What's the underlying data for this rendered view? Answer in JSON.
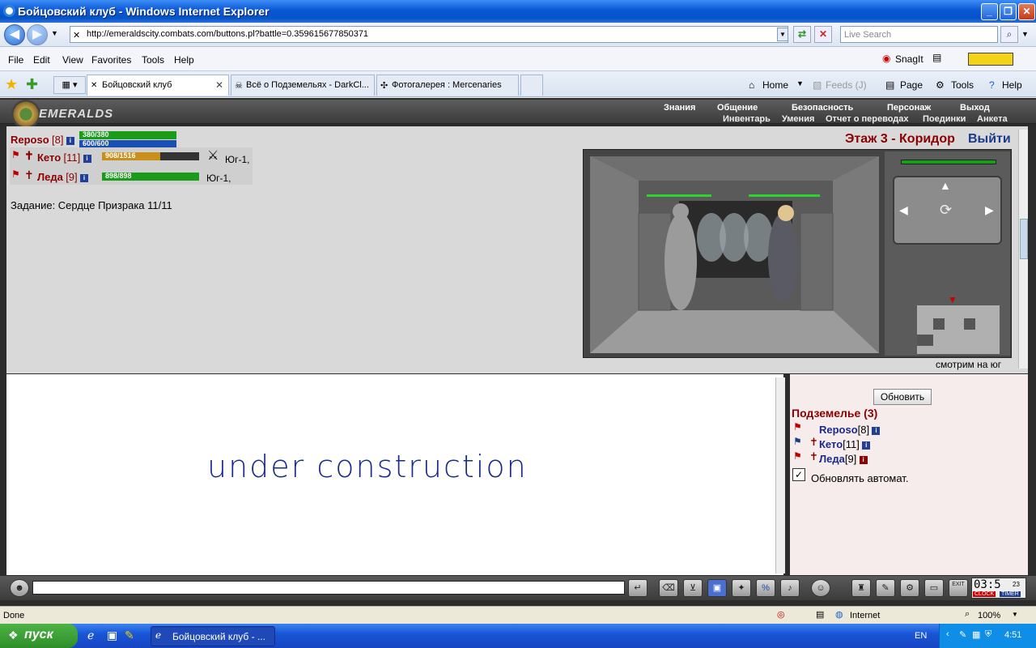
{
  "window": {
    "title": "Бойцовский клуб - Windows Internet Explorer"
  },
  "address": {
    "url": "http://emeraldscity.combats.com/buttons.pl?battle=0.359615677850371",
    "search_placeholder": "Live Search"
  },
  "menu": [
    "File",
    "Edit",
    "View",
    "Favorites",
    "Tools",
    "Help"
  ],
  "snagit": "SnagIt",
  "tabs": [
    {
      "label": "Бойцовский клуб"
    },
    {
      "label": "Всё о Подземельях - DarkCl..."
    },
    {
      "label": "Фотогалерея : Mercenaries"
    }
  ],
  "commands": {
    "home": "Home",
    "feeds": "Feeds (J)",
    "page": "Page",
    "tools": "Tools",
    "help": "Help"
  },
  "game": {
    "logo": "EMERALDS",
    "top_menu": [
      "Знания",
      "Общение",
      "Безопасность",
      "Персонаж",
      "Выход"
    ],
    "sub_menu": [
      "Инвентарь",
      "Умения",
      "Отчет о переводах",
      "Поединки",
      "Анкета"
    ],
    "player": {
      "name": "Reposo",
      "level": "[8]",
      "hp": "380/380",
      "mana": "600/600",
      "hp_frac": 1.0,
      "mana_frac": 1.0
    },
    "party": [
      {
        "name": "Кето",
        "level": "[11]",
        "hp": "908/1516",
        "hp_frac": 0.6,
        "dir": "Юг-1,"
      },
      {
        "name": "Леда",
        "level": "[9]",
        "hp": "898/898",
        "hp_frac": 1.0,
        "dir": "Юг-1,"
      }
    ],
    "quest": "Задание: Сердце Призрака 11/11",
    "location": "Этаж 3 - Коридор",
    "exit": "Выйти",
    "facing": "смотрим на юг",
    "construction": "under construction",
    "refresh_button": "Обновить",
    "dungeon_title": "Подземелье (3)",
    "dungeon_members": [
      {
        "name": "Reposo",
        "level": "[8]"
      },
      {
        "name": "Кето",
        "level": "[11]"
      },
      {
        "name": "Леда",
        "level": "[9]"
      }
    ],
    "auto_refresh": "Обновлять автомат.",
    "clock": "03:5",
    "clock_small": "23",
    "clock_label": "CLOCK",
    "timer_label": "TIMER",
    "exit_label": "EXIT"
  },
  "status": {
    "text": "Done",
    "zone": "Internet",
    "zoom": "100%"
  },
  "taskbar": {
    "start": "пуск",
    "task": "Бойцовский клуб - ...",
    "lang": "EN",
    "time": "4:51"
  },
  "colors": {
    "titlebar": "#0a58d6",
    "hp_green": "#1a9b1a",
    "mana_blue": "#1a4fb4",
    "hp_orange": "#c8901a",
    "game_red": "#8b0000",
    "construction": "#1a2a8c"
  }
}
